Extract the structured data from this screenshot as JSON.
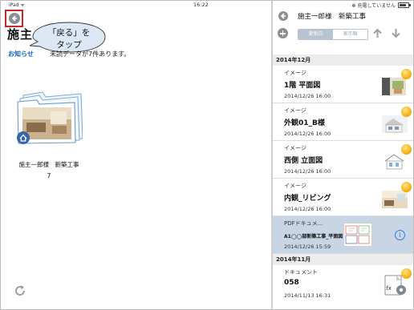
{
  "status_bar": {
    "carrier": "iPad ᯤ",
    "time": "16:22",
    "charging": "✻ 充電していません"
  },
  "left": {
    "title": "施主",
    "callout": {
      "line1": "「戻る」を",
      "line2": "タップ"
    },
    "notice_label": "お知らせ",
    "notice_text": "未読データが7件あります。",
    "project": {
      "name": "施主一郎様　新築工事",
      "count": "7"
    }
  },
  "right": {
    "header_title": "施主一郎様　新築工事",
    "segments": [
      "更新日",
      "表示順"
    ],
    "sections": [
      {
        "label": "2014年12月",
        "items": [
          {
            "type": "イメージ",
            "name": "1階 平面図",
            "date": "2014/12/26 16:00"
          },
          {
            "type": "イメージ",
            "name": "外観01_B様",
            "date": "2014/12/26 16:00"
          },
          {
            "type": "イメージ",
            "name": "西側 立面図",
            "date": "2014/12/26 16:00"
          },
          {
            "type": "イメージ",
            "name": "内観_リビング",
            "date": "2014/12/26 16:00"
          },
          {
            "type": "PDFドキュメ...",
            "name": "A1◯◯部新築工事_平面図",
            "date": "2014/12/26 15:59",
            "selected": true
          }
        ]
      },
      {
        "label": "2014年11月",
        "items": [
          {
            "type": "ドキュメント",
            "name": "058",
            "date": "2014/11/13 16:31"
          }
        ]
      }
    ],
    "file_ext": ".fx"
  },
  "colors": {
    "accent": "#1565c0",
    "highlight": "#c62828",
    "selected_row": "#c7d5e4",
    "badge": "#f6a800"
  },
  "icons": [
    "back-arrow-icon",
    "add-icon",
    "arrow-up-icon",
    "arrow-down-icon",
    "refresh-icon",
    "folder-icon",
    "home-icon",
    "info-icon",
    "status-badge-icon",
    "gear-icon"
  ]
}
